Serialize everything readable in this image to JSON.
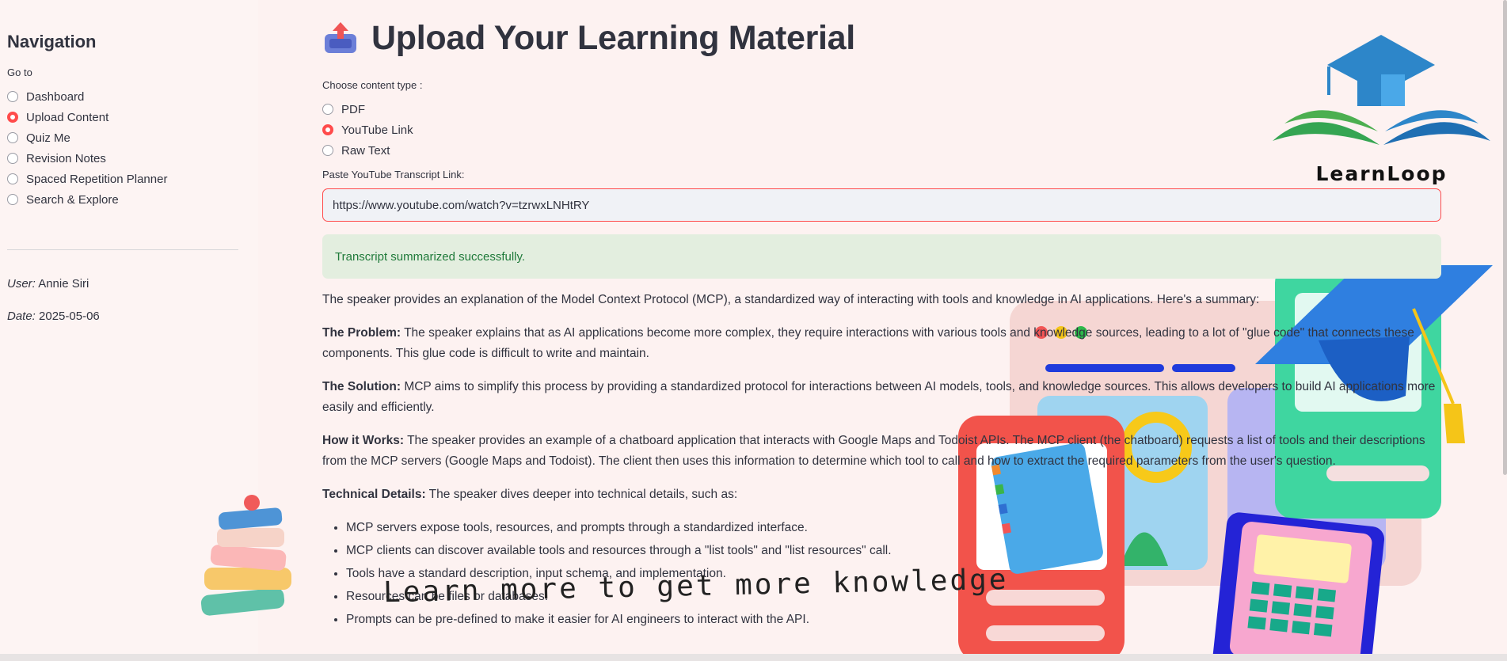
{
  "sidebar": {
    "title": "Navigation",
    "goto_label": "Go to",
    "items": [
      {
        "label": "Dashboard",
        "selected": false
      },
      {
        "label": "Upload Content",
        "selected": true
      },
      {
        "label": "Quiz Me",
        "selected": false
      },
      {
        "label": "Revision Notes",
        "selected": false
      },
      {
        "label": "Spaced Repetition Planner",
        "selected": false
      },
      {
        "label": "Search & Explore",
        "selected": false
      }
    ],
    "user_label": "User:",
    "user_value": "Annie Siri",
    "date_label": "Date:",
    "date_value": "2025-05-06"
  },
  "main": {
    "title": "Upload Your Learning Material",
    "content_type_label": "Choose content type :",
    "content_types": [
      {
        "label": "PDF",
        "selected": false
      },
      {
        "label": "YouTube Link",
        "selected": true
      },
      {
        "label": "Raw Text",
        "selected": false
      }
    ],
    "link_label": "Paste YouTube Transcript Link:",
    "link_value": "https://www.youtube.com/watch?v=tzrwxLNHtRY",
    "success_message": "Transcript summarized successfully.",
    "summary": {
      "intro": "The speaker provides an explanation of the Model Context Protocol (MCP), a standardized way of interacting with tools and knowledge in AI applications. Here's a summary:",
      "problem_title": "The Problem:",
      "problem_text": " The speaker explains that as AI applications become more complex, they require interactions with various tools and knowledge sources, leading to a lot of \"glue code\" that connects these components. This glue code is difficult to write and maintain.",
      "solution_title": "The Solution:",
      "solution_text": " MCP aims to simplify this process by providing a standardized protocol for interactions between AI models, tools, and knowledge sources. This allows developers to build AI applications more easily and efficiently.",
      "how_title": "How it Works:",
      "how_text": " The speaker provides an example of a chatboard application that interacts with Google Maps and Todoist APIs. The MCP client (the chatboard) requests a list of tools and their descriptions from the MCP servers (Google Maps and Todoist). The client then uses this information to determine which tool to call and how to extract the required parameters from the user's question.",
      "tech_title": "Technical Details:",
      "tech_text": " The speaker dives deeper into technical details, such as:",
      "bullets": [
        "MCP servers expose tools, resources, and prompts through a standardized interface.",
        "MCP clients can discover available tools and resources through a \"list tools\" and \"list resources\" call.",
        "Tools have a standard description, input schema, and implementation.",
        "Resources can be files or databases.",
        "Prompts can be pre-defined to make it easier for AI engineers to interact with the API."
      ]
    }
  },
  "decor": {
    "logo_text": "LearnLoop",
    "banner_text": "Learn more to get more knowledge"
  },
  "colors": {
    "accent": "#ff4b4b",
    "background": "#fdf2f1",
    "success_bg": "#e3eedf",
    "success_text": "#1f7a3a"
  }
}
